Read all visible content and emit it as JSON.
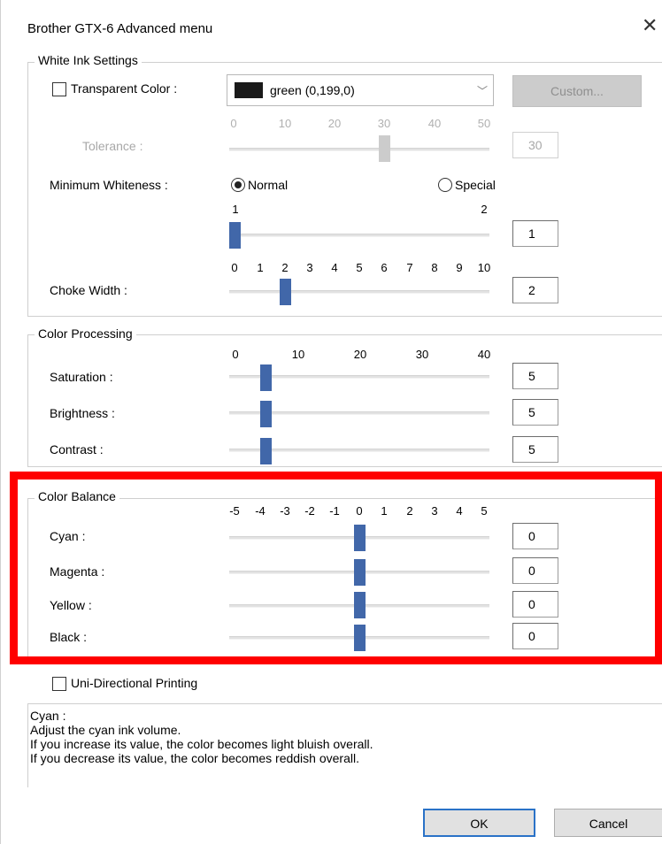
{
  "window": {
    "title": "Brother GTX-6 Advanced menu",
    "close_glyph": "✕"
  },
  "white_ink": {
    "group_label": "White Ink Settings",
    "transparent_color": {
      "label": "Transparent Color :",
      "checked": false,
      "selected_value": "green (0,199,0)",
      "swatch_color": "#1a1a1a",
      "custom_button": "Custom..."
    },
    "tolerance": {
      "label": "Tolerance :",
      "ticks": [
        "0",
        "10",
        "20",
        "30",
        "40",
        "50"
      ],
      "value": "30",
      "enabled": false
    },
    "minimum_whiteness": {
      "label": "Minimum Whiteness :",
      "options": [
        "Normal",
        "Special"
      ],
      "selected": "Normal",
      "ticks": [
        "1",
        "2"
      ],
      "value": "1"
    },
    "choke_width": {
      "label": "Choke Width :",
      "ticks": [
        "0",
        "1",
        "2",
        "3",
        "4",
        "5",
        "6",
        "7",
        "8",
        "9",
        "10"
      ],
      "value": "2"
    }
  },
  "color_processing": {
    "group_label": "Color Processing",
    "ticks": [
      "0",
      "10",
      "20",
      "30",
      "40"
    ],
    "sliders": [
      {
        "label": "Saturation :",
        "value": "5"
      },
      {
        "label": "Brightness :",
        "value": "5"
      },
      {
        "label": "Contrast :",
        "value": "5"
      }
    ]
  },
  "color_balance": {
    "group_label": "Color Balance",
    "ticks": [
      "-5",
      "-4",
      "-3",
      "-2",
      "-1",
      "0",
      "1",
      "2",
      "3",
      "4",
      "5"
    ],
    "sliders": [
      {
        "label": "Cyan :",
        "value": "0"
      },
      {
        "label": "Magenta :",
        "value": "0"
      },
      {
        "label": "Yellow :",
        "value": "0"
      },
      {
        "label": "Black :",
        "value": "0"
      }
    ],
    "highlight_color": "#ff0000"
  },
  "uni_directional": {
    "label": "Uni-Directional Printing",
    "checked": false
  },
  "description": {
    "lines": [
      "Cyan :",
      "Adjust the cyan ink volume.",
      "If you increase its value, the color becomes light bluish overall.",
      "If you decrease its value, the color becomes reddish overall."
    ]
  },
  "buttons": {
    "ok": "OK",
    "cancel": "Cancel"
  },
  "colors": {
    "slider_thumb": "#4167a9",
    "default_button_border": "#2a72c7"
  }
}
